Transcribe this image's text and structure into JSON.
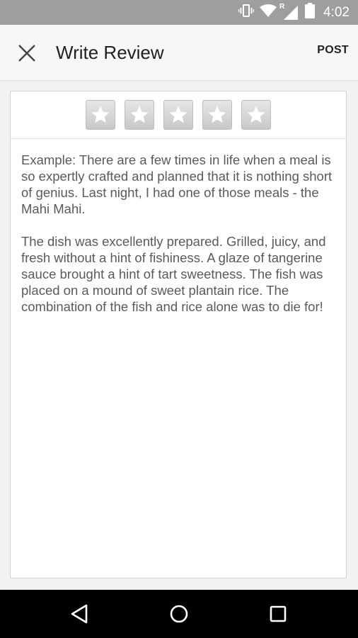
{
  "status_bar": {
    "time": "4:02",
    "icons": [
      "vibrate-icon",
      "wifi-icon",
      "signal-roaming-icon",
      "battery-icon"
    ],
    "roaming_label": "R",
    "background": "#9e9e9e"
  },
  "app_bar": {
    "title": "Write Review",
    "post_label": "POST",
    "close_icon": "close-icon"
  },
  "rating": {
    "max_stars": 5,
    "selected": 0
  },
  "review": {
    "placeholder": "Example: There are a few times in life when a meal is so expertly crafted and planned that it is nothing short of genius. Last night, I had one of those meals - the Mahi Mahi.\n\nThe dish was excellently prepared. Grilled, juicy, and fresh without a hint of fishiness. A glaze of tangerine sauce brought a hint of tart sweetness. The fish was placed on a mound of sweet plantain rice. The combination of the fish and rice alone was to die for!"
  },
  "nav_bar": {
    "icons": [
      "back-icon",
      "home-icon",
      "recents-icon"
    ]
  }
}
